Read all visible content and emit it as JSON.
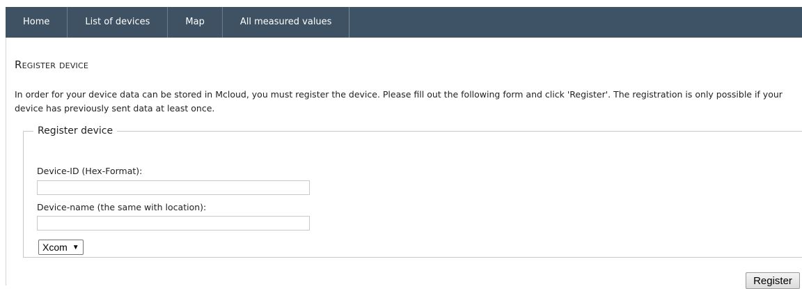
{
  "nav": {
    "tabs": [
      {
        "label": "Home"
      },
      {
        "label": "List of devices"
      },
      {
        "label": "Map"
      },
      {
        "label": "All measured values"
      }
    ]
  },
  "page": {
    "title": "Register device",
    "intro": "In order for your device data can be stored in Mcloud, you must register the device. Please fill out the following form and click 'Register'. The registration is only possible if your device has previously sent data at least once."
  },
  "form": {
    "legend": "Register device",
    "device_id": {
      "label": "Device-ID (Hex-Format):",
      "value": ""
    },
    "device_name": {
      "label": "Device-name (the same with location):",
      "value": ""
    },
    "type_select": {
      "selected": "Xcom"
    },
    "submit_label": "Register"
  },
  "colors": {
    "navbar_bg": "#3f5366",
    "nav_text": "#ffffff"
  }
}
